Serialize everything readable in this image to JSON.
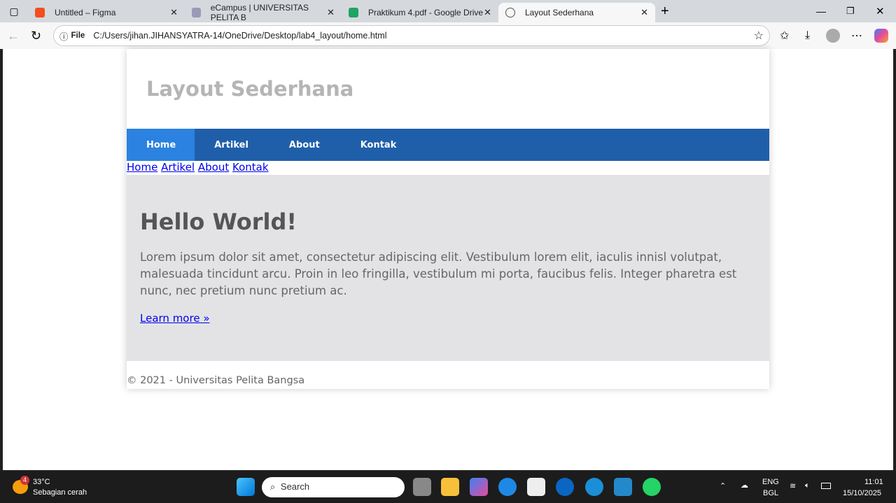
{
  "browser": {
    "tabs": [
      {
        "title": "Untitled – Figma",
        "color": "#f24e1e"
      },
      {
        "title": "eCampus | UNIVERSITAS PELITA B",
        "color": "#9a9ab8"
      },
      {
        "title": "Praktikum 4.pdf - Google Drive",
        "color": "#1fa463"
      },
      {
        "title": "Layout Sederhana",
        "color": "#666666",
        "active": true
      }
    ],
    "url_label": "File",
    "url": "C:/Users/jihan.JIHANSYATRA-14/OneDrive/Desktop/lab4_layout/home.html"
  },
  "page": {
    "title": "Layout Sederhana",
    "nav": [
      {
        "label": "Home",
        "active": true
      },
      {
        "label": "Artikel"
      },
      {
        "label": "About"
      },
      {
        "label": "Kontak"
      }
    ],
    "hero": {
      "heading": "Hello World!",
      "text": "Lorem ipsum dolor sit amet, consectetur adipiscing elit. Vestibulum lorem elit, iaculis innisl volutpat, malesuada tincidunt arcu. Proin in leo fringilla, vestibulum mi porta, faucibus felis. Integer pharetra est nunc, nec pretium nunc pretium ac.",
      "link": "Learn more »"
    },
    "footer": "© 2021 - Universitas Pelita Bangsa"
  },
  "taskbar": {
    "weather_temp": "33°C",
    "weather_desc": "Sebagian cerah",
    "weather_badge": "4",
    "search": "Search",
    "lang1": "ENG",
    "lang2": "BGL",
    "time": "11:01",
    "date": "15/10/2025"
  }
}
